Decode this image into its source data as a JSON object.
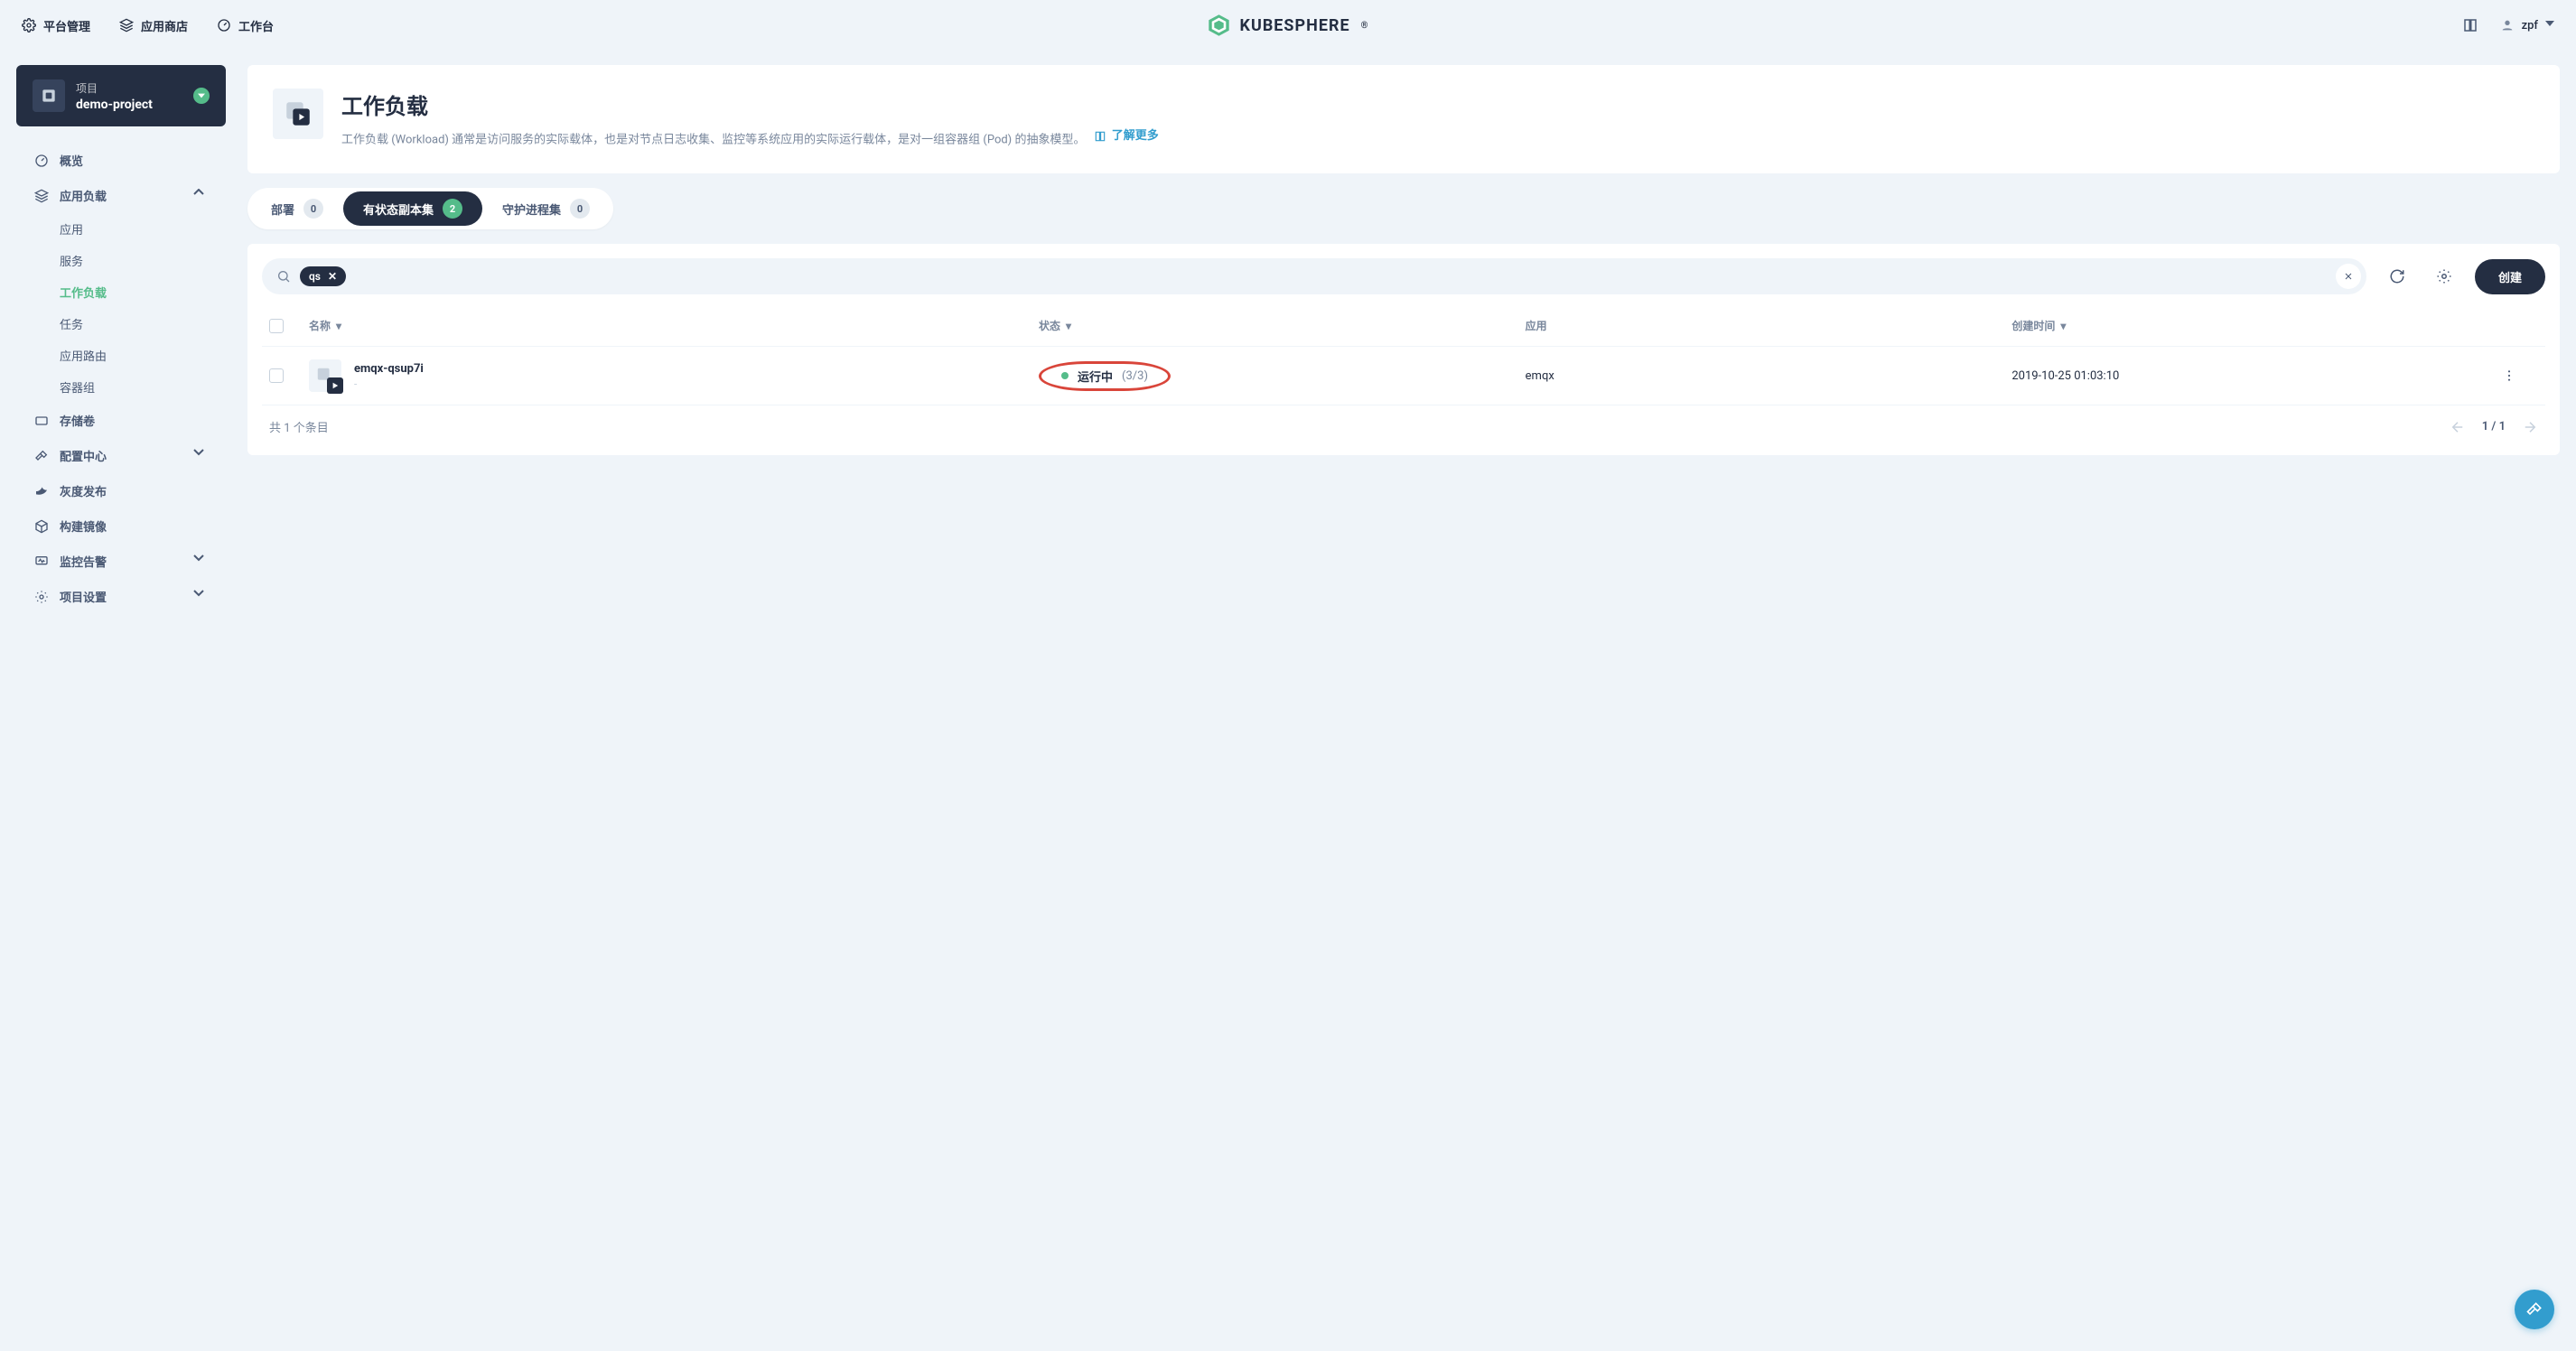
{
  "topnav": {
    "platform": "平台管理",
    "app_store": "应用商店",
    "workbench": "工作台",
    "logo_text": "KUBESPHERE",
    "user_name": "zpf"
  },
  "project": {
    "kind": "项目",
    "name": "demo-project"
  },
  "sidebar": {
    "overview": "概览",
    "app_workload": "应用负载",
    "app_workload_children": {
      "apps": "应用",
      "services": "服务",
      "workloads": "工作负载",
      "jobs": "任务",
      "routes": "应用路由",
      "pods": "容器组"
    },
    "volumes": "存储卷",
    "config": "配置中心",
    "grayscale": "灰度发布",
    "image_build": "构建镜像",
    "monitoring": "监控告警",
    "project_settings": "项目设置"
  },
  "page_header": {
    "title": "工作负载",
    "description": "工作负载 (Workload) 通常是访问服务的实际载体，也是对节点日志收集、监控等系统应用的实际运行载体，是对一组容器组 (Pod) 的抽象模型。",
    "learn_more": "了解更多"
  },
  "tabs": {
    "deploy": {
      "label": "部署",
      "count": "0"
    },
    "stateful": {
      "label": "有状态副本集",
      "count": "2"
    },
    "daemon": {
      "label": "守护进程集",
      "count": "0"
    }
  },
  "toolbar": {
    "search_tag": "qs",
    "create_label": "创建"
  },
  "table": {
    "head": {
      "name": "名称",
      "status": "状态",
      "app": "应用",
      "created": "创建时间"
    },
    "rows": [
      {
        "name": "emqx-qsup7i",
        "sub": "-",
        "status_text": "运行中",
        "status_count": "(3/3)",
        "app": "emqx",
        "created": "2019-10-25 01:03:10"
      }
    ],
    "total_prefix": "共 ",
    "total_count": "1",
    "total_suffix": " 个条目",
    "page_pos": "1 / 1"
  }
}
